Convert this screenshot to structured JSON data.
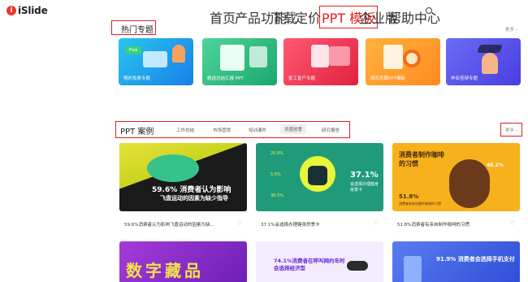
{
  "header": {
    "logo_text": "iSlide",
    "nav": [
      "首页",
      "产品功能",
      "下载",
      "定价",
      "PPT 模板",
      "企业版",
      "帮助中心"
    ]
  },
  "hot_topics": {
    "title": "热门专题",
    "more": "更多 ›",
    "items": [
      {
        "label": "限时免费专题",
        "badge": "Free"
      },
      {
        "label": "精选总结汇报 PPT"
      },
      {
        "label": "复工复产专题"
      },
      {
        "label": "简历竞聘PPT模板"
      },
      {
        "label": "毕业答辩专题"
      }
    ]
  },
  "cases": {
    "title": "PPT 案例",
    "tabs": [
      "工作总结",
      "市场营销",
      "培训课件",
      "灵感创意",
      "研究报告"
    ],
    "active_tab": "灵感创意",
    "more": "更多 ›",
    "cards": [
      {
        "caption": "59.6%消费者认为影响飞盘运动的因素为缺…",
        "img_big": "59.6% 消费者认为影响",
        "img_sub": "飞盘运动的因素为缺少指导"
      },
      {
        "caption": "37.1%会选择办理健身房季卡",
        "img_big": "37.1%",
        "img_sub": "会选择办理健身房季卡",
        "stats": [
          "20.9%",
          "5.5%",
          "36.5%"
        ]
      },
      {
        "caption": "51.8%消费者有亲自制作咖啡的习惯",
        "img_big": "消费者制作咖啡的习惯",
        "img_pct": "51.8%",
        "img_pct2": "48.2%",
        "img_sub": "消费者有亲自制作咖啡的习惯"
      }
    ],
    "row2": [
      {
        "text": "数字藏品"
      },
      {
        "text": "74.1%消费者在呼叫网约车时会选择经济型"
      },
      {
        "text": "91.9% 消费者会选择手机支付"
      }
    ]
  }
}
